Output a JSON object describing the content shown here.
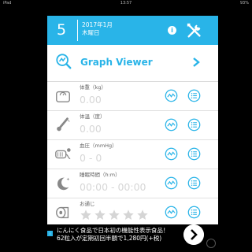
{
  "status_bar": {
    "carrier": "iPad",
    "time": "13:57",
    "battery": "93%"
  },
  "header": {
    "day": "5",
    "year_month": "2017年1月",
    "weekday": "木曜日"
  },
  "graph_viewer": {
    "label": "Graph Viewer"
  },
  "rows": [
    {
      "label": "体重（kg）",
      "value": "0.00"
    },
    {
      "label": "体温（度）",
      "value": "0.00"
    },
    {
      "label": "血圧（mmHg）",
      "value": "0 - 0"
    },
    {
      "label": "睡眠時間（h:m）",
      "value": "00:00 - 00:00"
    },
    {
      "label": "お通じ",
      "rating": 0,
      "max_rating": 5
    }
  ],
  "ad": {
    "info_label": "i",
    "line1": "にんにく食品で日本初の機能性表示食品！",
    "line2": "62粒入が定期初回半額で1,280円(+税)"
  },
  "colors": {
    "accent": "#29b4e8",
    "placeholder": "#d7d7d7",
    "star": "#d5d5d5"
  }
}
